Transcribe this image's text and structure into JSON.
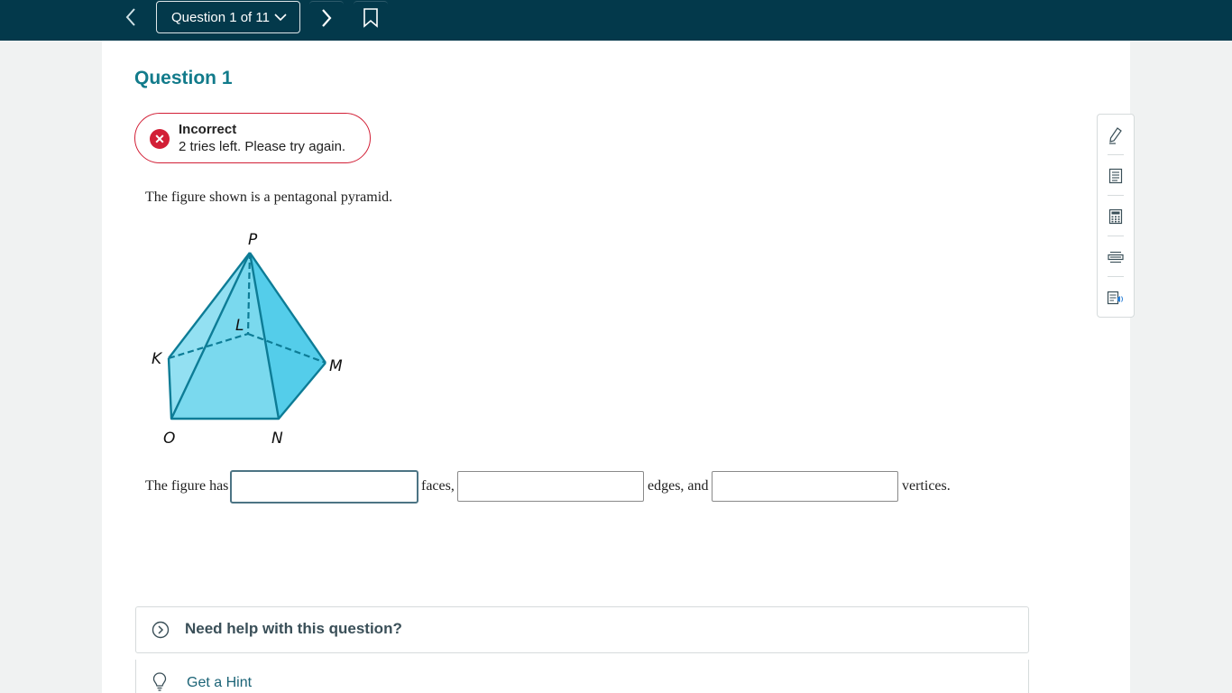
{
  "topbar": {
    "question_selector_label": "Question 1 of 11"
  },
  "question": {
    "title": "Question 1",
    "prompt": "The figure shown is a pentagonal pyramid."
  },
  "alert": {
    "title": "Incorrect",
    "message": "2 tries left. Please try again."
  },
  "figure": {
    "vertex_labels": {
      "apex": "P",
      "l": "L",
      "k": "K",
      "m": "M",
      "o": "O",
      "n": "N"
    },
    "fill_color": "#7ddcf0",
    "stroke_color": "#0d7c96"
  },
  "answer": {
    "text_before": "The figure has",
    "after_faces": "faces,",
    "after_edges": "edges, and",
    "after_vertices": "vertices.",
    "faces_value": "",
    "edges_value": "",
    "vertices_value": ""
  },
  "help": {
    "need_help_label": "Need help with this question?",
    "hint_label": "Get a Hint"
  },
  "tools": [
    {
      "icon": "pencil-icon"
    },
    {
      "icon": "notes-icon"
    },
    {
      "icon": "calculator-icon"
    },
    {
      "icon": "line-reader-icon"
    },
    {
      "icon": "text-to-speech-icon"
    }
  ],
  "colors": {
    "topbar": "#03394b",
    "accent": "#127b8b",
    "error": "#d21f36"
  }
}
